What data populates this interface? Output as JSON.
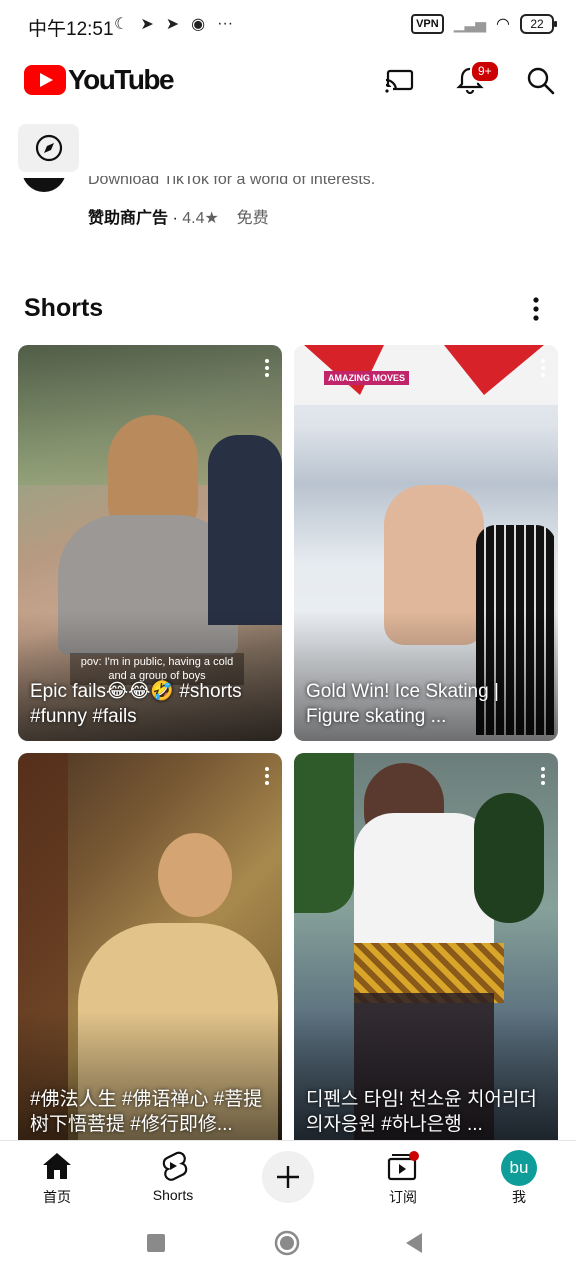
{
  "status": {
    "time": "中午12:51",
    "vpn": "VPN",
    "battery": "22"
  },
  "header": {
    "logo_text": "YouTube",
    "notification_count": "9+"
  },
  "ad": {
    "description": "Download TikTok for a world of interests.",
    "sponsored": "赞助商广告",
    "separator": "·",
    "rating": "4.4★",
    "price": "免费"
  },
  "shorts": {
    "section_title": "Shorts",
    "items": [
      {
        "title": "Epic fails😂😂🤣 #shorts #funny #fails",
        "overlay_caption": "pov: I'm in public, having a cold and a group of boys"
      },
      {
        "title": "Gold Win! Ice Skating | Figure skating ...",
        "badge": "AMAZING MOVES"
      },
      {
        "title": "#佛法人生 #佛语禅心 #菩提树下悟菩提 #修行即修..."
      },
      {
        "title": "디펜스 타임! 천소윤 치어리더 의자응원 #하나은행 ..."
      }
    ]
  },
  "nav": {
    "home": "首页",
    "shorts": "Shorts",
    "subscriptions": "订阅",
    "you": "我",
    "avatar_initials": "bu"
  },
  "colors": {
    "brand_red": "#ff0000",
    "badge_red": "#cc0000",
    "avatar_teal": "#0f9d9a"
  }
}
